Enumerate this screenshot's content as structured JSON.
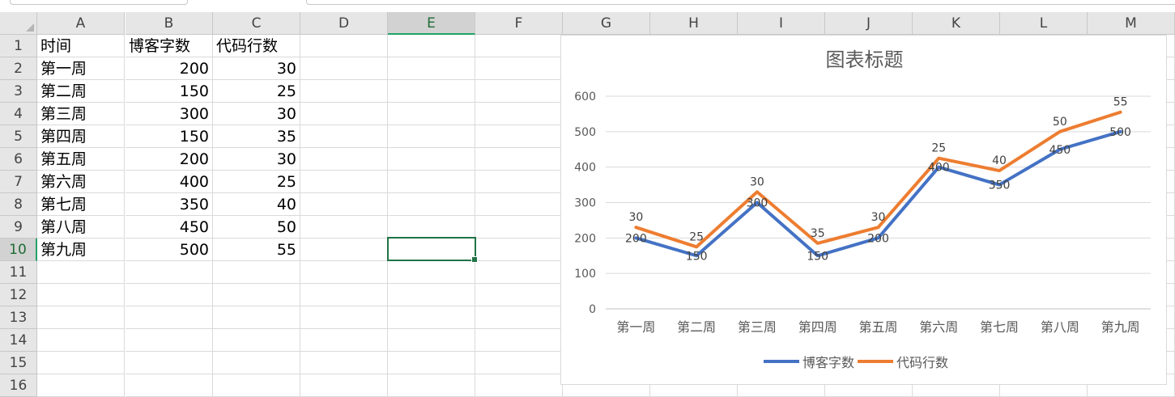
{
  "columns": [
    "A",
    "B",
    "C",
    "D",
    "E",
    "F",
    "G",
    "H",
    "I",
    "J",
    "K",
    "L",
    "M"
  ],
  "rows": [
    "1",
    "2",
    "3",
    "4",
    "5",
    "6",
    "7",
    "8",
    "9",
    "10",
    "11",
    "12",
    "13",
    "14",
    "15",
    "16"
  ],
  "active_cell": "E10",
  "table": {
    "headers": [
      "时间",
      "博客字数",
      "代码行数"
    ],
    "data": [
      [
        "第一周",
        "200",
        "30"
      ],
      [
        "第二周",
        "150",
        "25"
      ],
      [
        "第三周",
        "300",
        "30"
      ],
      [
        "第四周",
        "150",
        "35"
      ],
      [
        "第五周",
        "200",
        "30"
      ],
      [
        "第六周",
        "400",
        "25"
      ],
      [
        "第七周",
        "350",
        "40"
      ],
      [
        "第八周",
        "450",
        "50"
      ],
      [
        "第九周",
        "500",
        "55"
      ]
    ]
  },
  "chart_data": {
    "type": "line",
    "title": "图表标题",
    "categories": [
      "第一周",
      "第二周",
      "第三周",
      "第四周",
      "第五周",
      "第六周",
      "第七周",
      "第八周",
      "第九周"
    ],
    "series": [
      {
        "name": "博客字数",
        "values": [
          200,
          150,
          300,
          150,
          200,
          400,
          350,
          450,
          500
        ],
        "color": "#4472C4"
      },
      {
        "name": "代码行数",
        "values": [
          30,
          25,
          30,
          35,
          30,
          25,
          40,
          50,
          55
        ],
        "color": "#ED7D31"
      }
    ],
    "stacked": true,
    "ylim": [
      0,
      600
    ],
    "yticks": [
      0,
      100,
      200,
      300,
      400,
      500,
      600
    ],
    "grid": true,
    "legend": "bottom",
    "data_labels": true
  }
}
